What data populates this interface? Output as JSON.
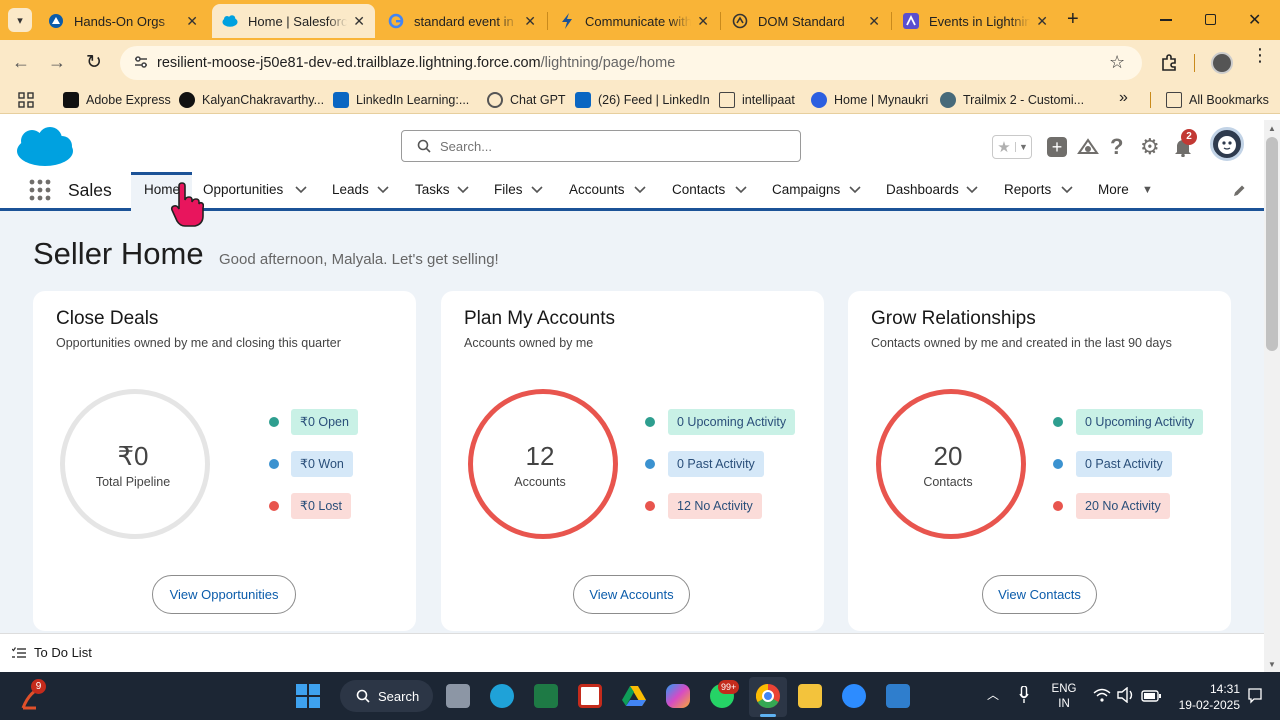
{
  "browser": {
    "tabs": [
      {
        "title": "Hands-On Orgs",
        "icon": "trailhead-icon"
      },
      {
        "title": "Home | Salesforce",
        "icon": "salesforce-cloud-icon",
        "active": true
      },
      {
        "title": "standard event in",
        "icon": "google-icon"
      },
      {
        "title": "Communicate with",
        "icon": "bolt-icon"
      },
      {
        "title": "DOM Standard",
        "icon": "whatwg-icon"
      },
      {
        "title": "Events in Lightnin",
        "icon": "salesforce-dev-icon"
      }
    ],
    "tab_close_glyph": "✕",
    "new_tab_glyph": "+",
    "url_host": "resilient-moose-j50e81-dev-ed.trailblaze.lightning.force.com",
    "url_path": "/lightning/page/home",
    "bookmarks": [
      {
        "label": "Adobe Express"
      },
      {
        "label": "KalyanChakravarthy..."
      },
      {
        "label": "LinkedIn Learning:..."
      },
      {
        "label": "Chat GPT"
      },
      {
        "label": "(26) Feed | LinkedIn"
      },
      {
        "label": "intellipaat"
      },
      {
        "label": "Home | Mynaukri"
      },
      {
        "label": "Trailmix 2 - Customi..."
      }
    ],
    "more_bookmarks_glyph": "»",
    "all_bookmarks": "All Bookmarks"
  },
  "sf": {
    "search_placeholder": "Search...",
    "notifications_count": "2",
    "app_name": "Sales",
    "nav": [
      "Home",
      "Opportunities",
      "Leads",
      "Tasks",
      "Files",
      "Accounts",
      "Contacts",
      "Campaigns",
      "Dashboards",
      "Reports",
      "More"
    ],
    "page_title": "Seller Home",
    "greeting": "Good afternoon, Malyala. Let's get selling!",
    "cards": [
      {
        "title": "Close Deals",
        "subtitle": "Opportunities owned by me and closing this quarter",
        "center_value": "₹0",
        "center_label": "Total Pipeline",
        "pills": [
          "₹0 Open",
          "₹0 Won",
          "₹0 Lost"
        ],
        "button": "View Opportunities"
      },
      {
        "title": "Plan My Accounts",
        "subtitle": "Accounts owned by me",
        "center_value": "12",
        "center_label": "Accounts",
        "pills": [
          "0 Upcoming Activity",
          "0 Past Activity",
          "12 No Activity"
        ],
        "button": "View Accounts"
      },
      {
        "title": "Grow Relationships",
        "subtitle": "Contacts owned by me and created in the last 90 days",
        "center_value": "20",
        "center_label": "Contacts",
        "pills": [
          "0 Upcoming Activity",
          "0 Past Activity",
          "20 No Activity"
        ],
        "button": "View Contacts"
      }
    ],
    "todo": "To Do List"
  },
  "taskbar": {
    "widget_badge": "9",
    "search": "Search",
    "whatsapp_badge": "99+",
    "lang_line1": "ENG",
    "lang_line2": "IN",
    "time": "14:31",
    "date": "19-02-2025"
  },
  "colors": {
    "tabstrip": "#f9b437",
    "toolbar": "#fbe9c8",
    "sf_blue": "#1b5297",
    "ring_red": "#e8554e",
    "ring_grey": "#e5e5e5",
    "dot_green": "#2e9e8f",
    "dot_blue": "#3b92d0",
    "dot_red": "#e8554e"
  }
}
